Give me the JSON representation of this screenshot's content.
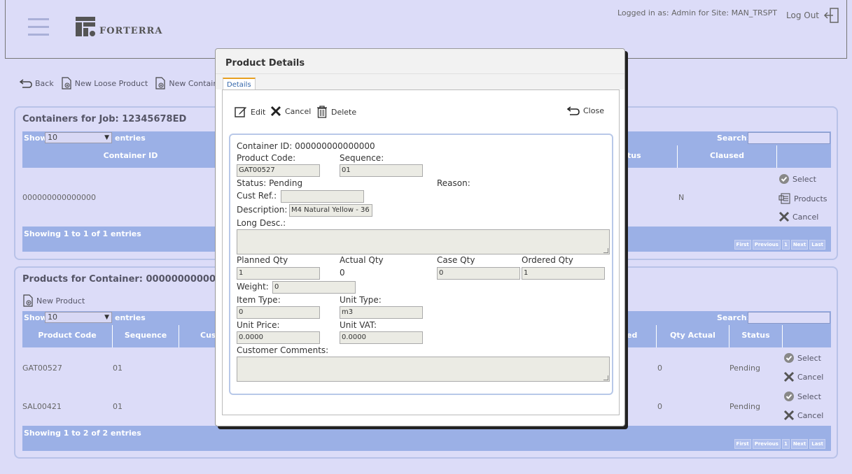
{
  "header": {
    "logo_text": "FORTERRA",
    "logged_in": "Logged in as: Admin for Site: MAN_TRSPT",
    "logout_label": "Log Out"
  },
  "toolbar": {
    "back": "Back",
    "new_loose_product": "New Loose Product",
    "new_container": "New Containe"
  },
  "containers": {
    "title": "Containers for Job: 12345678ED",
    "show_label": "Show",
    "entries_value": "10",
    "entries_label": "entries",
    "search_label": "Search:",
    "columns": [
      "Container ID",
      "tus",
      "Claused"
    ],
    "row": {
      "container_id": "000000000000000",
      "claused": "N"
    },
    "actions": [
      "Select",
      "Products",
      "Cancel"
    ],
    "footer": "Showing 1 to 1 of 1 entries",
    "pager": [
      "First",
      "Previous",
      "1",
      "Next",
      "Last"
    ]
  },
  "products": {
    "title": "Products for Container: 00000000000000",
    "new_product": "New Product",
    "show_label": "Show",
    "entries_value": "10",
    "entries_label": "entries",
    "search_label": "Search:",
    "columns": [
      "Product Code",
      "Sequence",
      "Cust",
      "ed",
      "Qty Actual",
      "Status"
    ],
    "rows": [
      {
        "code": "GAT00527",
        "seq": "01",
        "qty_actual": "0",
        "status": "Pending"
      },
      {
        "code": "SAL00421",
        "seq": "01",
        "qty_actual": "0",
        "status": "Pending"
      }
    ],
    "row_actions": [
      "Select",
      "Cancel"
    ],
    "footer": "Showing 1 to 2 of 2 entries",
    "pager": [
      "First",
      "Previous",
      "1",
      "Next",
      "Last"
    ]
  },
  "modal": {
    "title": "Product Details",
    "tab": "Details",
    "edit": "Edit",
    "cancel": "Cancel",
    "delete": "Delete",
    "close": "Close",
    "container_id": "Container ID: 000000000000000",
    "product_code_label": "Product Code:",
    "product_code": "GAT00527",
    "sequence_label": "Sequence:",
    "sequence": "01",
    "status": "Status: Pending",
    "reason_label": "Reason:",
    "cust_ref_label": "Cust Ref.:",
    "cust_ref": "",
    "description_label": "Description:",
    "description": "M4 Natural Yellow - 36",
    "long_desc_label": "Long Desc.:",
    "planned_qty_label": "Planned Qty",
    "planned_qty": "1",
    "actual_qty_label": "Actual Qty",
    "actual_qty": "0",
    "case_qty_label": "Case Qty",
    "case_qty": "0",
    "ordered_qty_label": "Ordered Qty",
    "ordered_qty": "1",
    "weight_label": "Weight:",
    "weight": "0",
    "item_type_label": "Item Type:",
    "item_type": "0",
    "unit_type_label": "Unit Type:",
    "unit_type": "m3",
    "unit_price_label": "Unit Price:",
    "unit_price": "0.0000",
    "unit_vat_label": "Unit VAT:",
    "unit_vat": "0.0000",
    "customer_comments_label": "Customer Comments:"
  }
}
